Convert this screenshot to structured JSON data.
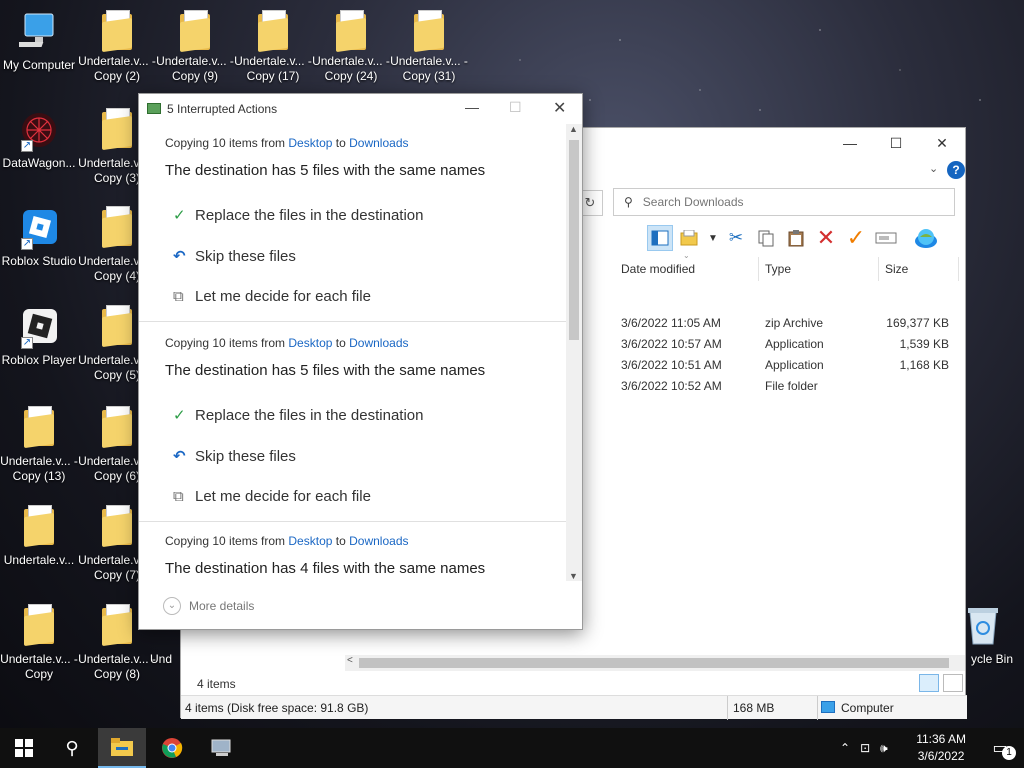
{
  "desktop": {
    "icons": [
      {
        "label": "My Computer"
      },
      {
        "label": "Undertale.v... - Copy (2)"
      },
      {
        "label": "Undertale.v... - Copy (9)"
      },
      {
        "label": "Undertale.v... - Copy (17)"
      },
      {
        "label": "Undertale.v... - Copy (24)"
      },
      {
        "label": "Undertale.v... - Copy (31)"
      },
      {
        "label": "DataWagon..."
      },
      {
        "label": "Undertale.v... - Copy (3)"
      },
      {
        "label": "Roblox Studio"
      },
      {
        "label": "Undertale.v... - Copy (4)"
      },
      {
        "label": "Roblox Player"
      },
      {
        "label": "Undertale.v... - Copy (5)"
      },
      {
        "label": "Undertale.v... - Copy (13)"
      },
      {
        "label": "Undertale.v... - Copy (6)"
      },
      {
        "label": "Undertale.v..."
      },
      {
        "label": "Undertale.v... - Copy (7)"
      },
      {
        "label": "Undertale.v... - Copy"
      },
      {
        "label": "Undertale.v... - Copy (8)"
      },
      {
        "label": "Und"
      },
      {
        "label": "ycle Bin"
      }
    ]
  },
  "explorer": {
    "controls": {
      "minimize": "—",
      "maximize": "☐",
      "close": "✕"
    },
    "search_placeholder": "Search Downloads",
    "columns": [
      "Date modified",
      "Type",
      "Size"
    ],
    "files": [
      {
        "date": "3/6/2022 11:05 AM",
        "type": "zip Archive",
        "size": "169,377 KB"
      },
      {
        "date": "3/6/2022 10:57 AM",
        "type": "Application",
        "size": "1,539 KB"
      },
      {
        "date": "3/6/2022 10:51 AM",
        "type": "Application",
        "size": "1,168 KB"
      },
      {
        "date": "3/6/2022 10:52 AM",
        "type": "File folder",
        "size": ""
      }
    ],
    "item_count": "4 items",
    "status": {
      "summary": "4 items (Disk free space: 91.8 GB)",
      "size": "168 MB",
      "location": "Computer"
    }
  },
  "dialog": {
    "title": "5 Interrupted Actions",
    "groups": [
      {
        "copying": "Copying 10 items from",
        "from": "Desktop",
        "to_word": "to",
        "to": "Downloads",
        "heading": "The destination has 5 files with the same names",
        "options": [
          "Replace the files in the destination",
          "Skip these files",
          "Let me decide for each file"
        ]
      },
      {
        "copying": "Copying 10 items from",
        "from": "Desktop",
        "to_word": "to",
        "to": "Downloads",
        "heading": "The destination has 5 files with the same names",
        "options": [
          "Replace the files in the destination",
          "Skip these files",
          "Let me decide for each file"
        ]
      },
      {
        "copying": "Copying 10 items from",
        "from": "Desktop",
        "to_word": "to",
        "to": "Downloads",
        "heading": "The destination has 4 files with the same names"
      }
    ],
    "more_details": "More details"
  },
  "taskbar": {
    "time": "11:36 AM",
    "date": "3/6/2022",
    "notification_count": "1"
  },
  "colors": {
    "link": "#1a67c4",
    "check": "#2e9e48",
    "taskbar": "#101010"
  }
}
